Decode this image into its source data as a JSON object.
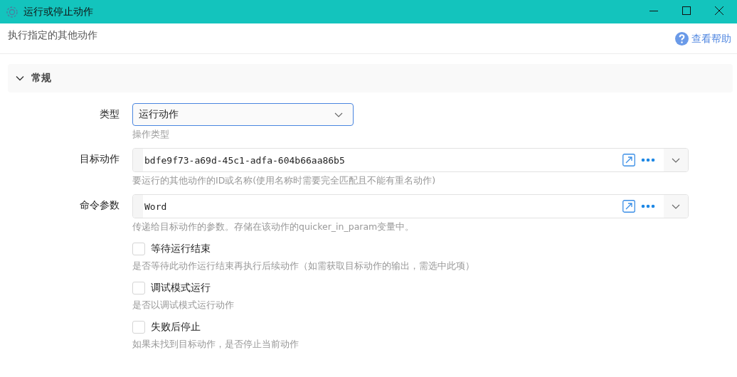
{
  "window": {
    "title": "运行或停止动作"
  },
  "header": {
    "description": "执行指定的其他动作",
    "help_link": "查看帮助"
  },
  "section": {
    "title": "常规",
    "expanded": true
  },
  "fields": [
    {
      "kind": "select",
      "label": "类型",
      "value": "运行动作",
      "hint": "操作类型"
    },
    {
      "kind": "combo",
      "label": "目标动作",
      "value": "bdfe9f73-a69d-45c1-adfa-604b66aa86b5",
      "hint": "要运行的其他动作的ID或名称(使用名称时需要完全匹配且不能有重名动作)"
    },
    {
      "kind": "combo",
      "label": "命令参数",
      "value": "Word",
      "hint": "传递给目标动作的参数。存储在该动作的quicker_in_param变量中。"
    },
    {
      "kind": "checkbox",
      "label": "等待运行结束",
      "checked": false,
      "hint": "是否等待此动作运行结束再执行后续动作（如需获取目标动作的输出，需选中此项）"
    },
    {
      "kind": "checkbox",
      "label": "调试模式运行",
      "checked": false,
      "hint": "是否以调试模式运行动作"
    },
    {
      "kind": "checkbox",
      "label": "失败后停止",
      "checked": false,
      "hint": "如果未找到目标动作，是否停止当前动作"
    }
  ]
}
